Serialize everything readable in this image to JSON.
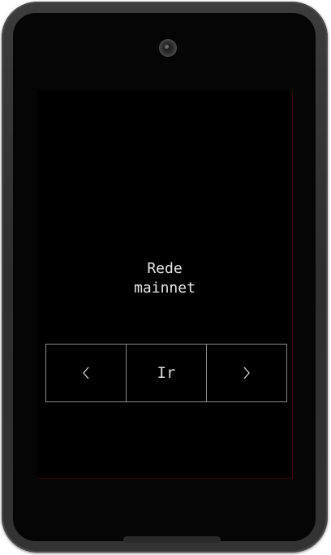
{
  "screen": {
    "network_title": "Rede",
    "network_name": "mainnet"
  },
  "nav": {
    "prev_icon": "chevron-left-icon",
    "go_label": "Ir",
    "next_icon": "chevron-right-icon"
  },
  "colors": {
    "device_body": "#333333",
    "screen_bg": "#000000",
    "text": "#e8e8e8",
    "button_border": "#8a8a8a"
  }
}
